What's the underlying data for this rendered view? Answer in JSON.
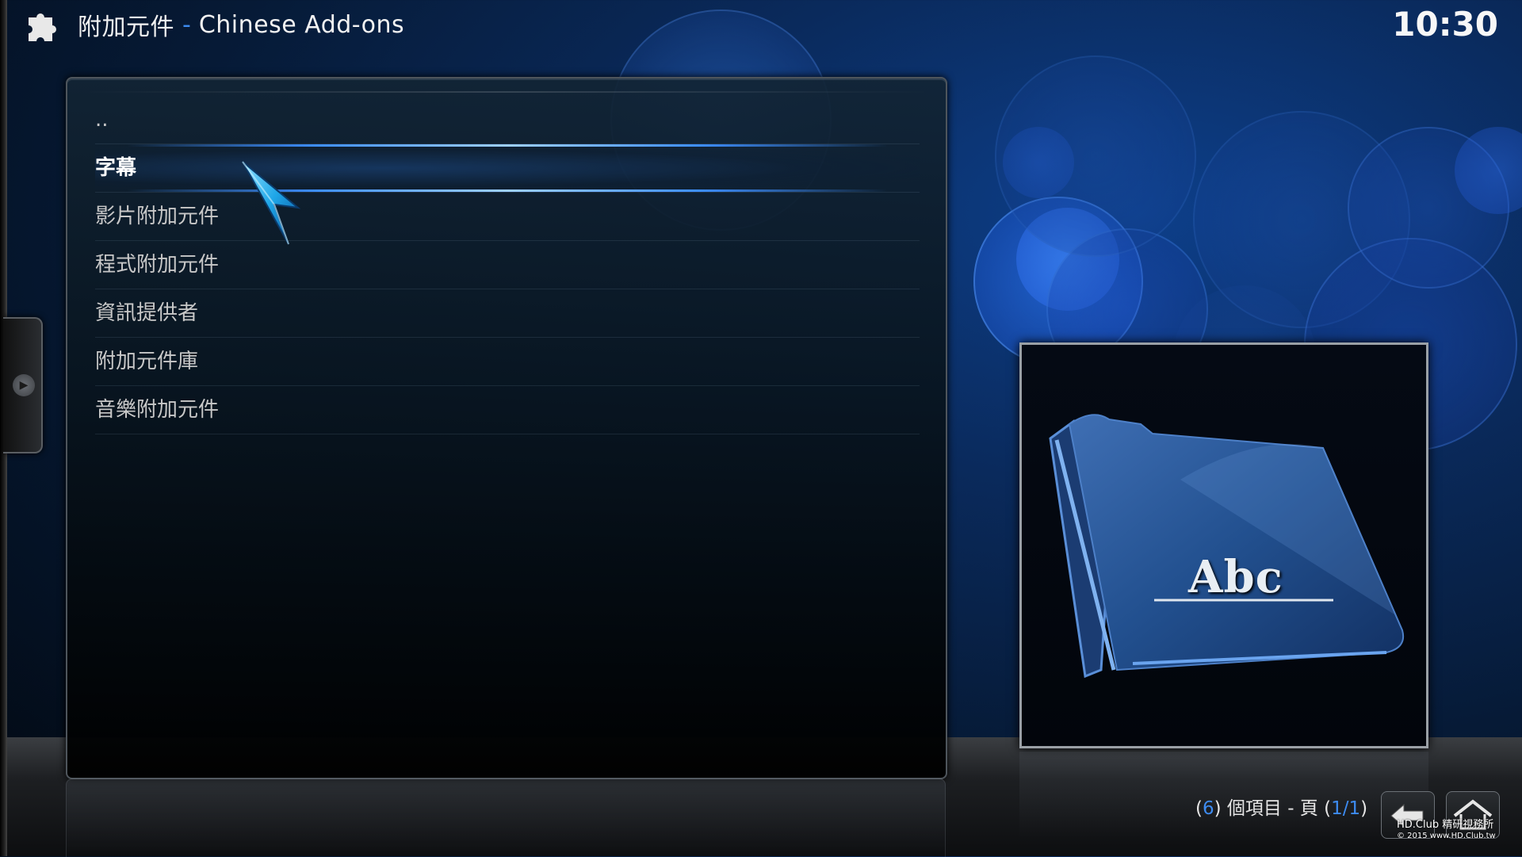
{
  "header": {
    "section_title": "附加元件",
    "separator": "-",
    "subtitle": "Chinese Add-ons",
    "icon": "puzzle-piece-icon"
  },
  "clock": "10:30",
  "list": {
    "items": [
      {
        "label": ".."
      },
      {
        "label": "字幕",
        "focused": true
      },
      {
        "label": "影片附加元件"
      },
      {
        "label": "程式附加元件"
      },
      {
        "label": "資訊提供者"
      },
      {
        "label": "附加元件庫"
      },
      {
        "label": "音樂附加元件"
      }
    ]
  },
  "thumbnail": {
    "icon": "folder-icon",
    "caption": "Abc"
  },
  "footer": {
    "open_paren": "(",
    "item_count": "6",
    "items_text": ") 個項目 - 頁 (",
    "page": "1/1",
    "close_paren": ")",
    "back_icon": "back-arrow-icon",
    "home_icon": "home-icon"
  },
  "watermark": {
    "line1": "HD.Club 精研視務所",
    "line2": "© 2015  www.HD.Club.tw"
  },
  "colors": {
    "accent": "#3d8bf0",
    "background": "#0a2a5c"
  }
}
